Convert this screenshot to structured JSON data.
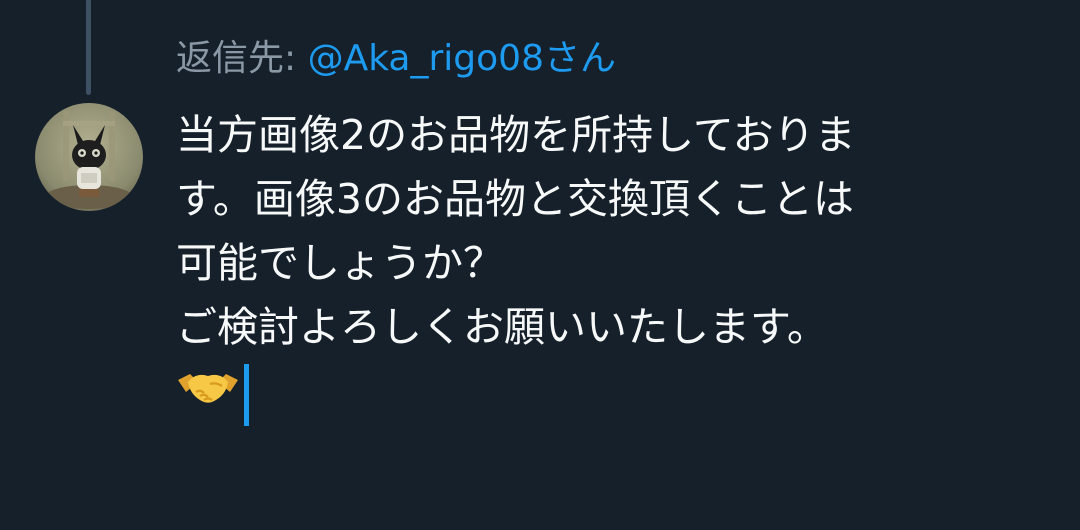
{
  "reply": {
    "prefix": "返信先: ",
    "handle": "@Aka_rigo08さん"
  },
  "tweet": {
    "lines": [
      "当方画像2のお品物を所持しておりま",
      "す。画像3のお品物と交換頂くことは",
      "可能でしょうか？",
      "ご検討よろしくお願いいたします。"
    ],
    "emoji_icon": "handshake-icon"
  },
  "colors": {
    "background": "#15202b",
    "text": "#f7f9f9",
    "muted": "#8b98a5",
    "accent": "#1d9bf0",
    "thread_line": "#3e5063"
  }
}
